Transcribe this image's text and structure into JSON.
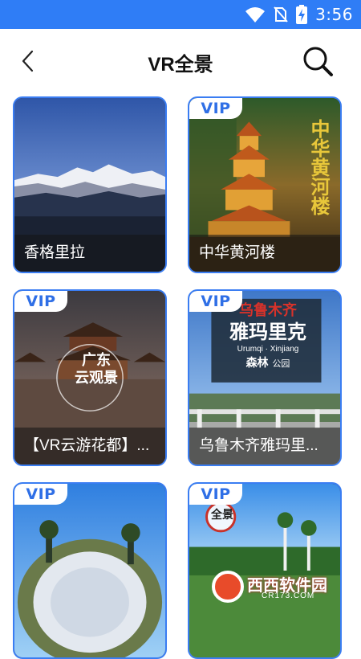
{
  "status_bar": {
    "time": "3:56",
    "icons": [
      "wifi-icon",
      "no-sim-icon",
      "battery-charging-icon"
    ]
  },
  "header": {
    "title": "VR全景",
    "back_icon": "chevron-left-icon",
    "search_icon": "search-icon"
  },
  "cards": [
    {
      "label": "香格里拉",
      "vip": false
    },
    {
      "label": "中华黄河楼",
      "vip": true,
      "vip_text": "VIP",
      "image_text": "中华黄河楼"
    },
    {
      "label": "【VR云游花都】...",
      "vip": true,
      "vip_text": "VIP",
      "image_text": [
        "广东",
        "云观景"
      ]
    },
    {
      "label": "乌鲁木齐雅玛里...",
      "vip": true,
      "vip_text": "VIP",
      "image_text": [
        "乌鲁木齐",
        "雅玛里克",
        "Urumqi · Xinjiang",
        "森林",
        "公园"
      ]
    },
    {
      "label": "",
      "vip": true,
      "vip_text": "VIP"
    },
    {
      "label": "",
      "vip": true,
      "vip_text": "VIP",
      "image_text": "全景"
    }
  ],
  "watermark": {
    "text": "西西软件园",
    "sub": "CR173.COM"
  },
  "colors": {
    "status_bar": "#2f7df6",
    "card_border": "#3a7df2",
    "vip_text": "#2f6fe6"
  }
}
